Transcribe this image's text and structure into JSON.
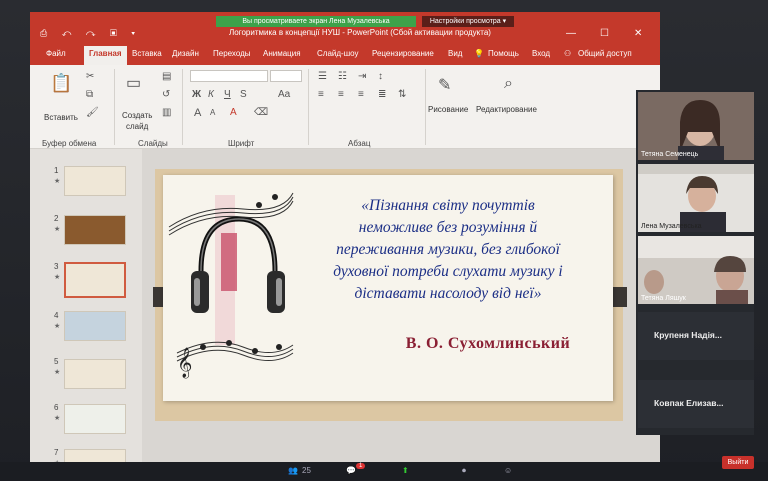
{
  "window": {
    "share_banner": "Вы просматриваете экран Лена Музалевська",
    "view_settings": "Настройки просмотра ▾",
    "title": "Логоритмика в концепції НУШ - PowerPoint (Сбой активации продукта)",
    "quick_access": "⎙ ↶ ↷ ▣ ▾",
    "minimize": "—",
    "restore": "☐",
    "close": "✕"
  },
  "menu": {
    "file": "Файл",
    "home": "Главная",
    "insert": "Вставка",
    "design": "Дизайн",
    "transitions": "Переходы",
    "animation": "Анимация",
    "slideshow": "Слайд-шоу",
    "review": "Рецензирование",
    "view": "Вид",
    "help": "Помощь",
    "signin": "Вход",
    "share": "Общий доступ"
  },
  "ribbon": {
    "paste": "Вставить",
    "create_slide_1": "Создать",
    "create_slide_2": "слайд",
    "drawing": "Рисование",
    "editing": "Редактирование",
    "group_clipboard": "Буфер обмена",
    "group_slides": "Слайды",
    "group_font": "Шрифт",
    "group_paragraph": "Абзац",
    "bold": "Ж",
    "italic": "К",
    "underline": "Ч",
    "strike": "S",
    "font_grow": "A",
    "font_shrink": "A"
  },
  "thumbnails": [
    {
      "num": "1",
      "star": "★"
    },
    {
      "num": "2",
      "star": "★"
    },
    {
      "num": "3",
      "star": "★"
    },
    {
      "num": "4",
      "star": "★"
    },
    {
      "num": "5",
      "star": "★"
    },
    {
      "num": "6",
      "star": "★"
    },
    {
      "num": "7",
      "star": "★"
    }
  ],
  "slide": {
    "quote_line1": "«Пізнання світу почуттів",
    "quote_line2": "неможливе без розуміння й",
    "quote_line3": "переживання музики, без глибокої",
    "quote_line4": "духовної потреби слухати музику і",
    "quote_line5": "діставати насолоду від неї»",
    "author": "В. О. Сухомлинський"
  },
  "participants": [
    {
      "name": "Тетяна Семенець"
    },
    {
      "name": "Лена Музалевська"
    },
    {
      "name": "Тетяна Ляшук"
    },
    {
      "name": "Крупеня Надія..."
    },
    {
      "name": "Ковпак Елизав..."
    }
  ],
  "bottombar": {
    "participants_count": "25",
    "chat_badge": "1",
    "leave": "Выйти"
  },
  "colors": {
    "accent": "#c4392b",
    "quote": "#1c2f86",
    "author": "#8a1f33"
  }
}
